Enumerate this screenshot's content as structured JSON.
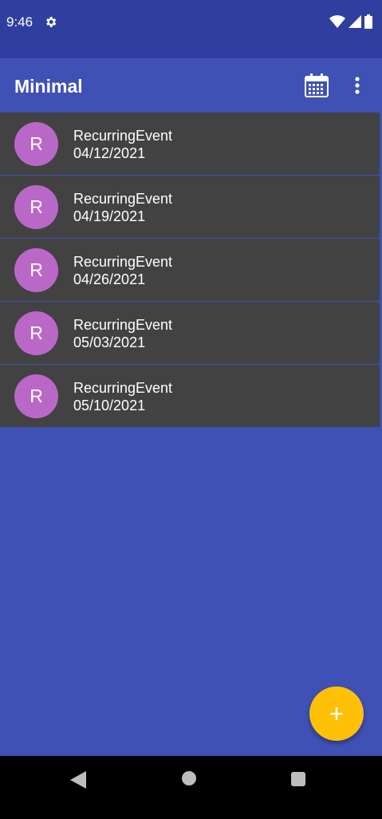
{
  "status_bar": {
    "time": "9:46",
    "icons": [
      "settings-icon",
      "wifi-icon",
      "signal-icon",
      "battery-icon"
    ]
  },
  "app_bar": {
    "title": "Minimal",
    "actions": [
      "calendar-icon",
      "more-vert-icon"
    ]
  },
  "events": [
    {
      "avatar": "R",
      "title": "RecurringEvent",
      "date": "04/12/2021"
    },
    {
      "avatar": "R",
      "title": "RecurringEvent",
      "date": "04/19/2021"
    },
    {
      "avatar": "R",
      "title": "RecurringEvent",
      "date": "04/26/2021"
    },
    {
      "avatar": "R",
      "title": "RecurringEvent",
      "date": "05/03/2021"
    },
    {
      "avatar": "R",
      "title": "RecurringEvent",
      "date": "05/10/2021"
    }
  ],
  "fab": {
    "label": "+"
  },
  "colors": {
    "primary": "#3f51b5",
    "primary_dark": "#303f9f",
    "row_bg": "#424242",
    "avatar": "#ba68c8",
    "fab": "#ffc107"
  }
}
